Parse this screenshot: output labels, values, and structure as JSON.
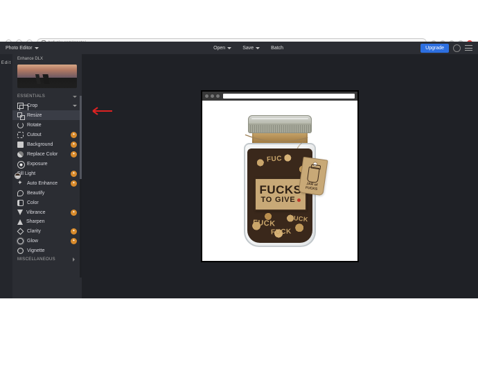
{
  "browser": {
    "url_display": "befunky.com/create/",
    "right_icons": [
      "ext",
      "ext",
      "ext",
      "ext",
      "ext-red"
    ]
  },
  "topbar": {
    "app_name": "Photo Editor",
    "menus": {
      "open": "Open",
      "save": "Save",
      "batch": "Batch"
    },
    "upgrade": "Upgrade"
  },
  "edit_col": {
    "label": "Edit"
  },
  "sidebar": {
    "tab_label": "Enhance DLX",
    "section_essentials": "ESSENTIALS",
    "section_misc": "MISCELLANEOUS",
    "tools": {
      "crop": "Crop",
      "resize": "Resize",
      "rotate": "Rotate",
      "cutout": "Cutout",
      "background": "Background",
      "replace_color": "Replace Color",
      "exposure": "Exposure",
      "fill_light": "Fill Light",
      "auto_enhance": "Auto Enhance",
      "beautify": "Beautify",
      "color": "Color",
      "vibrance": "Vibrance",
      "sharpen": "Sharpen",
      "clarity": "Clarity",
      "glow": "Glow",
      "vignette": "Vignette"
    }
  },
  "canvas": {
    "product_label_line1": "FUCKS",
    "product_label_line2": "TO GIVE",
    "tag_line1": "JAR of",
    "tag_line2": "FUCKS",
    "scatter1": "FUCK",
    "scatter2": "FUCK",
    "scatter3": "FUC",
    "scatter4": "FUCK"
  }
}
